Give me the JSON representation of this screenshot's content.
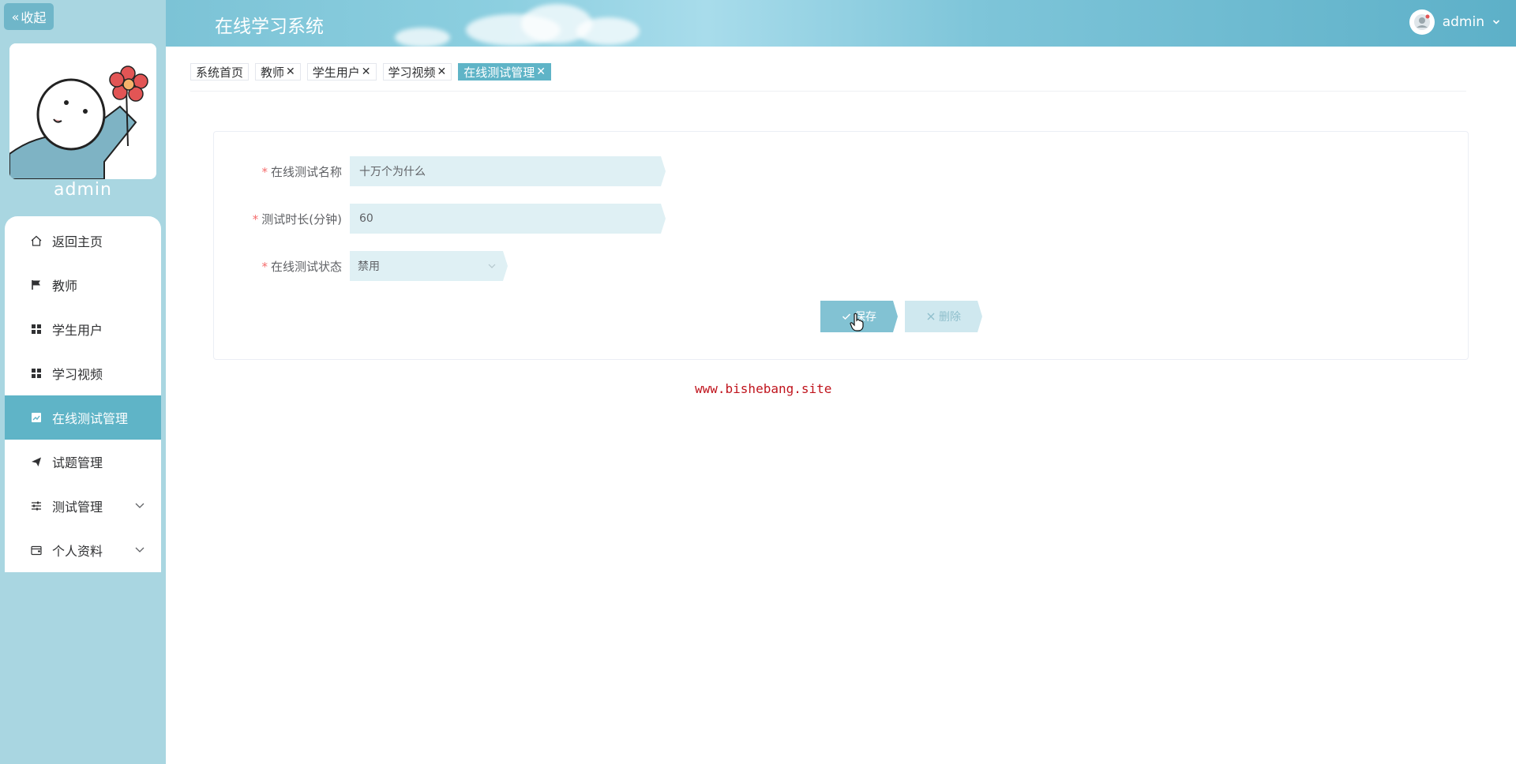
{
  "sidebar": {
    "collapse_label": "收起",
    "username": "admin",
    "items": [
      {
        "label": "返回主页",
        "icon": "home-icon"
      },
      {
        "label": "教师",
        "icon": "flag-icon"
      },
      {
        "label": "学生用户",
        "icon": "grid-icon"
      },
      {
        "label": "学习视频",
        "icon": "grid-icon"
      },
      {
        "label": "在线测试管理",
        "icon": "chart-icon",
        "active": true
      },
      {
        "label": "试题管理",
        "icon": "send-icon"
      },
      {
        "label": "测试管理",
        "icon": "sliders-icon",
        "has_submenu": true
      },
      {
        "label": "个人资料",
        "icon": "wallet-icon",
        "has_submenu": true
      }
    ]
  },
  "header": {
    "title": "在线学习系统",
    "username": "admin"
  },
  "tabs": [
    {
      "label": "系统首页",
      "closable": false
    },
    {
      "label": "教师",
      "closable": true
    },
    {
      "label": "学生用户",
      "closable": true
    },
    {
      "label": "学习视频",
      "closable": true
    },
    {
      "label": "在线测试管理",
      "closable": true,
      "active": true
    }
  ],
  "form": {
    "name_label": "在线测试名称",
    "name_value": "十万个为什么",
    "duration_label": "测试时长(分钟)",
    "duration_value": "60",
    "status_label": "在线测试状态",
    "status_value": "禁用",
    "required_mark": "*",
    "save_label": "保存",
    "delete_label": "删除"
  },
  "watermark": "www.bishebang.site",
  "colors": {
    "accent": "#5fb4c7",
    "sidebar_bg": "#a9d6e1",
    "field_bg": "#dff0f4",
    "required": "#f56c6c",
    "watermark": "#c0141d"
  }
}
